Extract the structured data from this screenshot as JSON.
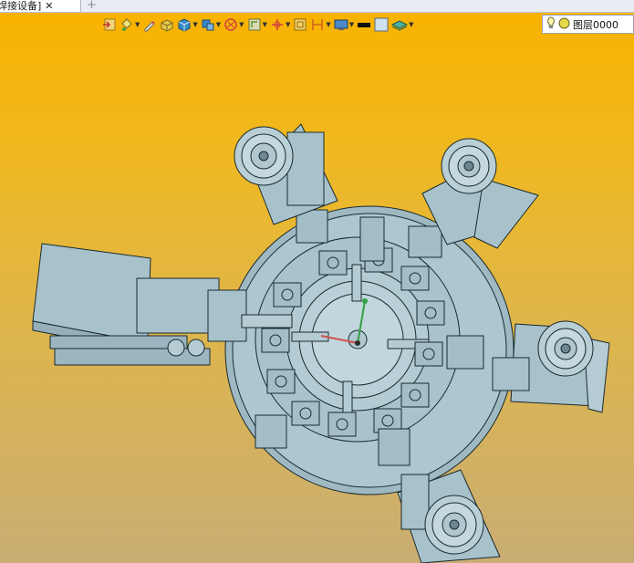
{
  "tab": {
    "title": "焊接设备]",
    "close_glyph": "✕",
    "new_glyph": "+"
  },
  "toolbar": {
    "items": [
      {
        "icon": "import-icon",
        "has_dropdown": false
      },
      {
        "icon": "paint-bucket-icon",
        "has_dropdown": true
      },
      {
        "icon": "pen-icon",
        "has_dropdown": false
      },
      {
        "icon": "box-yellow-icon",
        "has_dropdown": false
      },
      {
        "icon": "cube-blue-icon",
        "has_dropdown": true
      },
      {
        "icon": "assembly-icon",
        "has_dropdown": true
      },
      {
        "icon": "render-icon",
        "has_dropdown": true
      },
      {
        "icon": "view-orientation-icon",
        "has_dropdown": true
      },
      {
        "icon": "axes-icon",
        "has_dropdown": true
      },
      {
        "icon": "frame-icon",
        "has_dropdown": false
      },
      {
        "icon": "dimension-icon",
        "has_dropdown": true
      },
      {
        "icon": "display-icon",
        "has_dropdown": true
      },
      {
        "icon": "black-rect-icon",
        "has_dropdown": false
      },
      {
        "icon": "light-box-icon",
        "has_dropdown": false
      },
      {
        "icon": "layers-stack-icon",
        "has_dropdown": true
      }
    ]
  },
  "layer": {
    "name": "图层0000",
    "bulb_icon": "bulb-icon",
    "state_icon": "layer-state-icon"
  },
  "viewport": {
    "bg_top": "#f9b300",
    "bg_bottom": "#c9ad73",
    "model_fill": "#a8c2cc",
    "model_line": "#1a2a30",
    "axis_x_color": "#d05050",
    "axis_y_color": "#30a040"
  }
}
